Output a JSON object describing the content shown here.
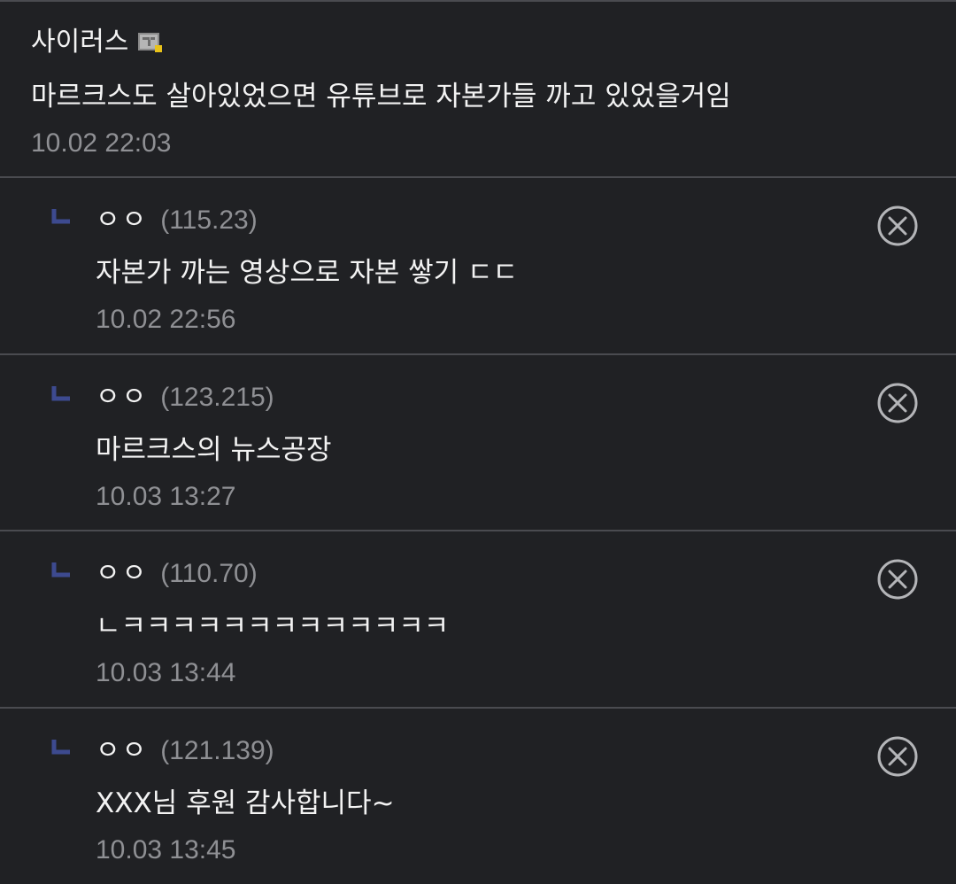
{
  "main_comment": {
    "nickname": "사이러스",
    "gallog_icon": "gallog-icon",
    "text": "마르크스도 살아있었으면 유튜브로 자본가들 까고 있었을거임",
    "date": "10.02 22:03"
  },
  "replies": [
    {
      "nickname": "ㅇㅇ",
      "ip": "(115.23)",
      "text": "자본가 까는 영상으로 자본 쌓기 ㄷㄷ",
      "date": "10.02 22:56"
    },
    {
      "nickname": "ㅇㅇ",
      "ip": "(123.215)",
      "text": "마르크스의 뉴스공장",
      "date": "10.03 13:27"
    },
    {
      "nickname": "ㅇㅇ",
      "ip": "(110.70)",
      "text": "ㄴㅋㅋㅋㅋㅋㅋㅋㅋㅋㅋㅋㅋㅋ",
      "date": "10.03 13:44"
    },
    {
      "nickname": "ㅇㅇ",
      "ip": "(121.139)",
      "text": "XXX님 후원 감사합니다~",
      "date": "10.03 13:45"
    }
  ],
  "icons": {
    "reply": "reply-arrow-icon",
    "delete": "delete-circle-x-icon"
  },
  "colors": {
    "background": "#202124",
    "divider": "#4a4b50",
    "text": "#f3f3f3",
    "meta": "#8f9094",
    "reply_arrow": "#3d4a8f"
  }
}
